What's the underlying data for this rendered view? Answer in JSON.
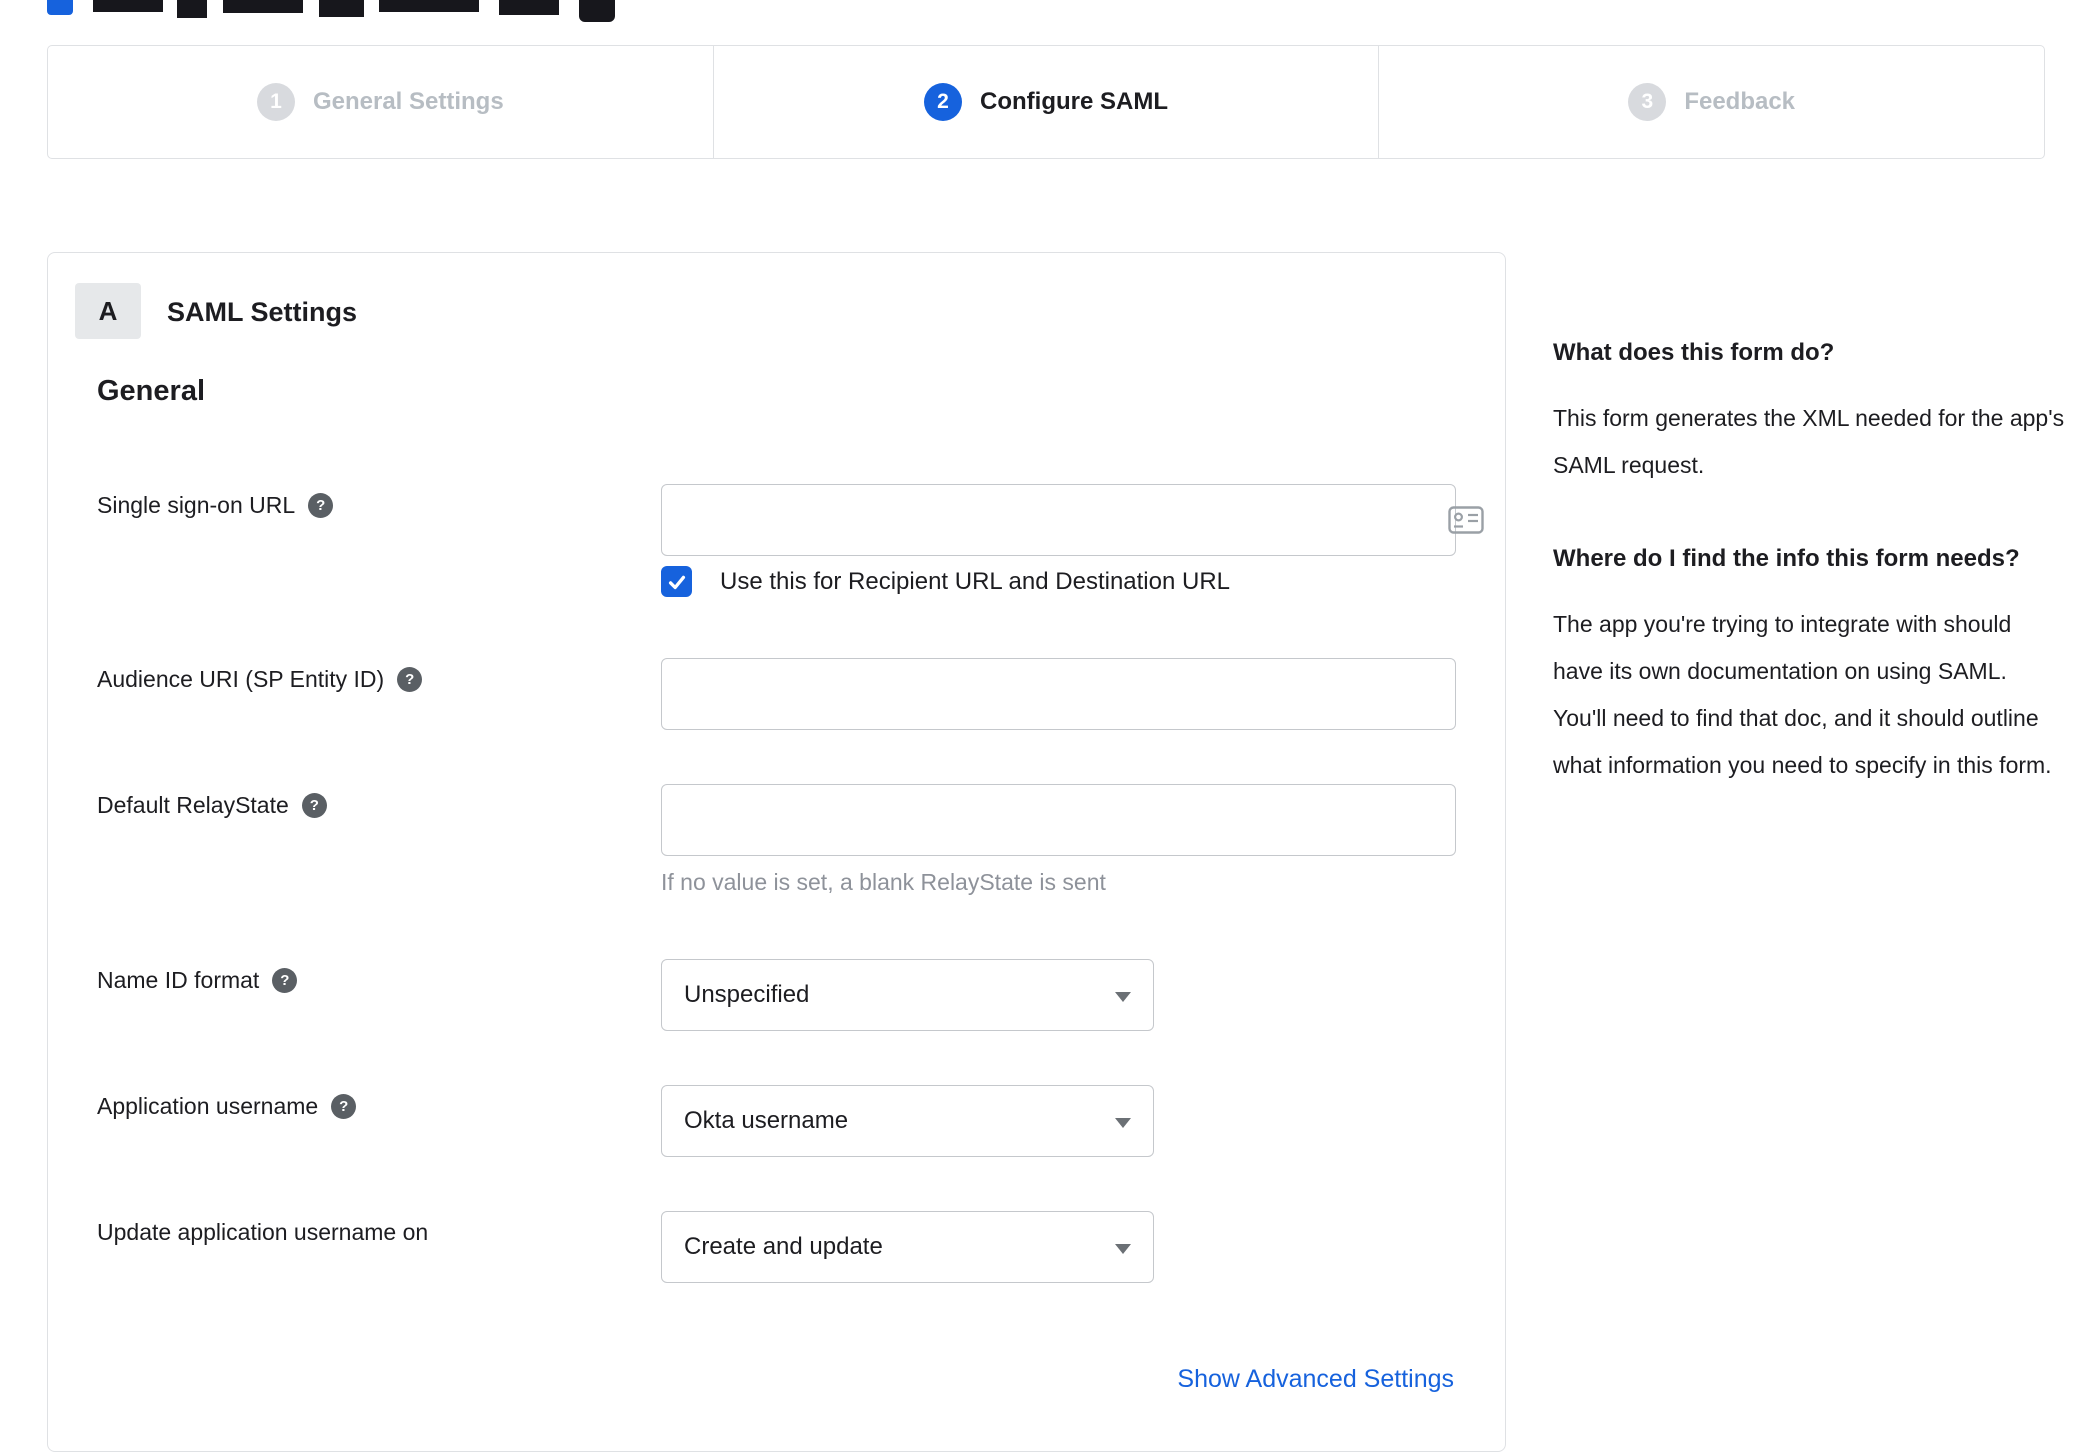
{
  "stepper": {
    "active_index": 1,
    "steps": [
      {
        "number": "1",
        "label": "General Settings",
        "state": "inactive"
      },
      {
        "number": "2",
        "label": "Configure SAML",
        "state": "active"
      },
      {
        "number": "3",
        "label": "Feedback",
        "state": "inactive"
      }
    ]
  },
  "form": {
    "badge": "A",
    "title": "SAML Settings",
    "section": "General",
    "sso": {
      "label": "Single sign-on URL",
      "value": "",
      "checkbox_label": "Use this for Recipient URL and Destination URL",
      "checkbox_checked": true
    },
    "audience": {
      "label": "Audience URI (SP Entity ID)",
      "value": ""
    },
    "relay": {
      "label": "Default RelayState",
      "value": "",
      "hint": "If no value is set, a blank RelayState is sent"
    },
    "name_id": {
      "label": "Name ID format",
      "value": "Unspecified"
    },
    "app_username": {
      "label": "Application username",
      "value": "Okta username"
    },
    "update_username": {
      "label": "Update application username on",
      "value": "Create and update"
    },
    "advanced_link": "Show Advanced Settings"
  },
  "help_panel": {
    "sections": [
      {
        "heading": "What does this form do?",
        "body": "This form generates the XML needed for the app's SAML request."
      },
      {
        "heading": "Where do I find the info this form needs?",
        "body": "The app you're trying to integrate with should have its own documentation on using SAML. You'll need to find that doc, and it should outline what information you need to specify in this form."
      }
    ]
  },
  "icons": {
    "help": "question-icon",
    "sso_field": "autofill-card-icon",
    "checkbox": "check-icon",
    "select": "chevron-down-icon"
  },
  "colors": {
    "accent_blue": "#1662dd",
    "link_blue": "#1662dd",
    "inactive_gray": "#b7bdc3",
    "border_gray": "#dfe1e4",
    "input_border": "#c5c8cc",
    "text": "#1d1d21",
    "hint_gray": "#8e929a"
  }
}
